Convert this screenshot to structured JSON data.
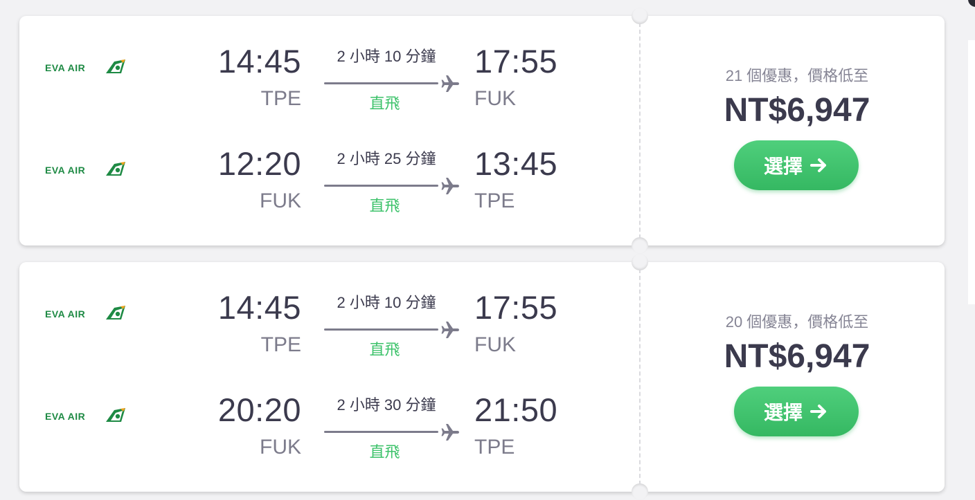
{
  "colors": {
    "accent_green": "#3cc26a",
    "button_green": "#3cc26a",
    "text_dark": "#3b3a4d",
    "text_muted": "#7c7b8b",
    "airline_green": "#1e8a44"
  },
  "results": [
    {
      "legs": [
        {
          "airline": "EVA AIR",
          "dep_time": "14:45",
          "dep_code": "TPE",
          "duration": "2 小時 10 分鐘",
          "stops": "直飛",
          "arr_time": "17:55",
          "arr_code": "FUK"
        },
        {
          "airline": "EVA AIR",
          "dep_time": "12:20",
          "dep_code": "FUK",
          "duration": "2 小時 25 分鐘",
          "stops": "直飛",
          "arr_time": "13:45",
          "arr_code": "TPE"
        }
      ],
      "deals_text": "21 個優惠，價格低至",
      "price": "NT$6,947",
      "select_label": "選擇"
    },
    {
      "legs": [
        {
          "airline": "EVA AIR",
          "dep_time": "14:45",
          "dep_code": "TPE",
          "duration": "2 小時 10 分鐘",
          "stops": "直飛",
          "arr_time": "17:55",
          "arr_code": "FUK"
        },
        {
          "airline": "EVA AIR",
          "dep_time": "20:20",
          "dep_code": "FUK",
          "duration": "2 小時 30 分鐘",
          "stops": "直飛",
          "arr_time": "21:50",
          "arr_code": "TPE"
        }
      ],
      "deals_text": "20 個優惠，價格低至",
      "price": "NT$6,947",
      "select_label": "選擇"
    }
  ],
  "icons": {
    "airline_logo": "eva-air-logo-icon",
    "plane": "plane-icon",
    "arrow": "arrow-right-icon"
  }
}
